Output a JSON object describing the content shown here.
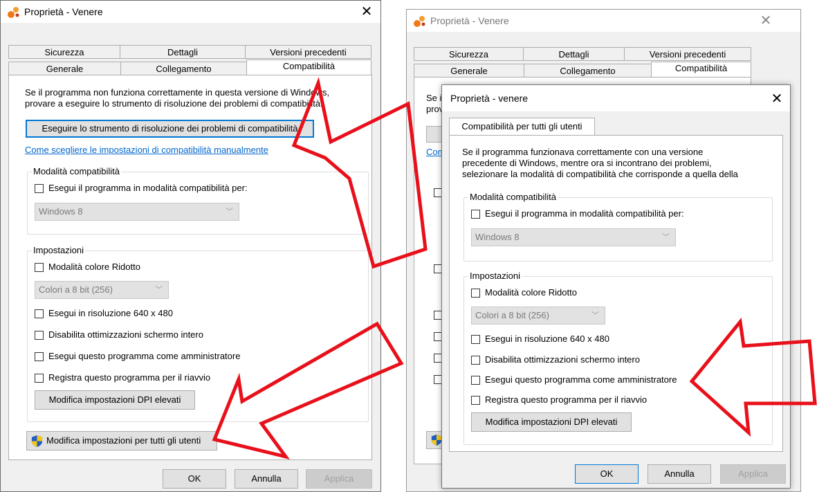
{
  "left": {
    "title": "Proprietà - Venere",
    "tabs_row1": [
      "Sicurezza",
      "Dettagli",
      "Versioni precedenti"
    ],
    "tabs_row2": [
      "Generale",
      "Collegamento",
      "Compatibilità"
    ],
    "intro": "Se il programma non funziona correttamente in questa versione di Windows, provare a eseguire lo strumento di risoluzione dei problemi di compatibilità.",
    "troubleshooter_button": "Eseguire lo strumento di risoluzione dei problemi di compatibilità",
    "manual_link": "Come scegliere le impostazioni di compatibilità manualmente",
    "compat_group": "Modalità compatibilità",
    "compat_check": "Esegui il programma in modalità compatibilità per:",
    "compat_select": "Windows 8",
    "settings_group": "Impostazioni",
    "reduced_color": "Modalità colore Ridotto",
    "color_select": "Colori a 8 bit (256)",
    "res_640": "Esegui in risoluzione 640 x 480",
    "disable_fullscreen": "Disabilita ottimizzazioni schermo intero",
    "run_admin": "Esegui questo programma come amministratore",
    "register_restart": "Registra questo programma per il riavvio",
    "dpi_button": "Modifica impostazioni DPI elevati",
    "all_users_button": "Modifica impostazioni per tutti gli utenti",
    "ok": "OK",
    "cancel": "Annulla",
    "apply": "Applica"
  },
  "right_back": {
    "title": "Proprietà - Venere",
    "tabs_row1": [
      "Sicurezza",
      "Dettagli",
      "Versioni precedenti"
    ],
    "tabs_row2": [
      "Generale",
      "Collegamento",
      "Compatibilità"
    ],
    "peek_intro": "Se i",
    "peek_intro2": "prov",
    "peek_link": "Com"
  },
  "right_front": {
    "title": "Proprietà - venere",
    "tab": "Compatibilità per tutti gli utenti",
    "intro_lines": [
      "Se il programma funzionava correttamente con una versione",
      "precedente di Windows, mentre ora si incontrano dei problemi,",
      "selezionare la modalità di compatibilità che corrisponde a quella della"
    ],
    "compat_group": "Modalità compatibilità",
    "compat_check": "Esegui il programma in modalità compatibilità per:",
    "compat_select": "Windows 8",
    "settings_group": "Impostazioni",
    "reduced_color": "Modalità colore Ridotto",
    "color_select": "Colori a 8 bit (256)",
    "res_640": "Esegui in risoluzione 640 x 480",
    "disable_fullscreen": "Disabilita ottimizzazioni schermo intero",
    "run_admin": "Esegui questo programma come amministratore",
    "register_restart": "Registra questo programma per il riavvio",
    "dpi_button": "Modifica impostazioni DPI elevati",
    "ok": "OK",
    "cancel": "Annulla",
    "apply": "Applica"
  },
  "icons": {
    "app_icon": "app-icon",
    "shield": "uac-shield-icon",
    "close": "close-icon",
    "chevron": "chevron-down-icon"
  },
  "colors": {
    "arrow_red": "#e8101a",
    "accent": "#0078d7",
    "link": "#0066cc"
  }
}
